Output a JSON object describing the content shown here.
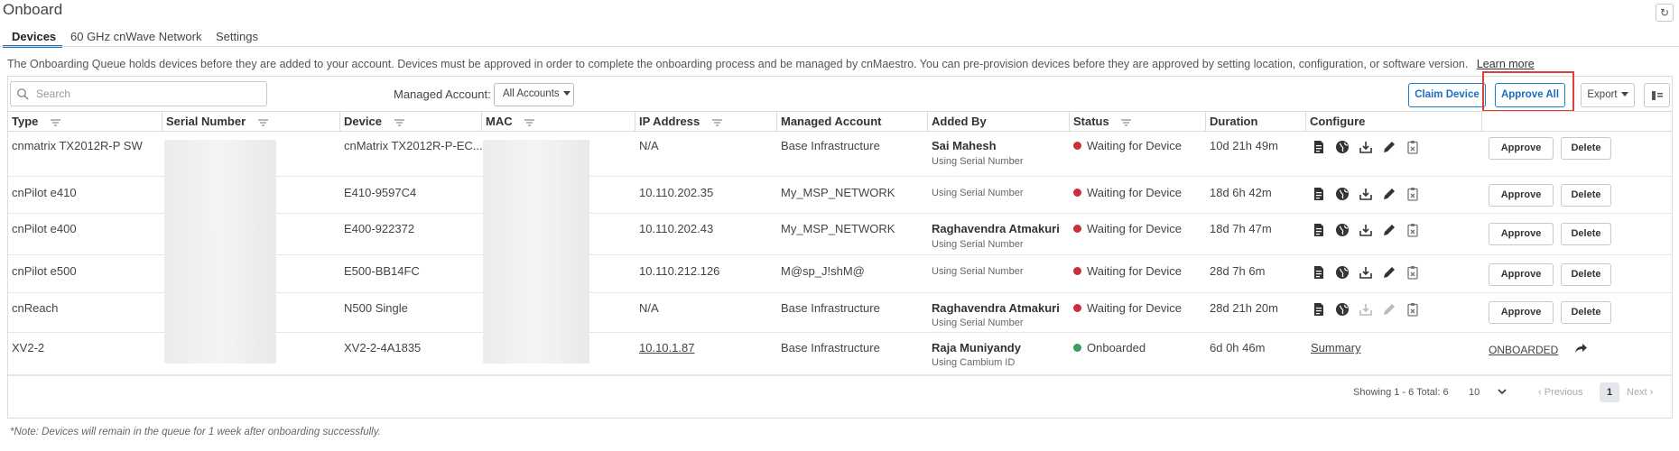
{
  "header": {
    "title": "Onboard",
    "refresh_icon": "refresh-icon"
  },
  "tabs": [
    {
      "label": "Devices",
      "active": true
    },
    {
      "label": "60 GHz cnWave Network",
      "active": false
    },
    {
      "label": "Settings",
      "active": false
    }
  ],
  "info": {
    "text": "The Onboarding Queue holds devices before they are added to your account. Devices must be approved in order to complete the onboarding process and be managed by cnMaestro. You can pre-provision devices before they are approved by setting location, configuration, or software version.",
    "learn_more": "Learn more"
  },
  "toolbar": {
    "search_placeholder": "Search",
    "search_value": "",
    "managed_account_label": "Managed Account:",
    "managed_account_value": "All Accounts",
    "claim_device": "Claim Device",
    "approve_all": "Approve All",
    "export": "Export",
    "columns_icon": "columns-icon"
  },
  "columns": [
    "Type",
    "Serial Number",
    "Device",
    "MAC",
    "IP Address",
    "Managed Account",
    "Added By",
    "Status",
    "Duration",
    "Configure"
  ],
  "rows": [
    {
      "type": "cnmatrix TX2012R-P SW",
      "device": "cnMatrix TX2012R-P-EC...",
      "ip": "N/A",
      "account": "Base Infrastructure",
      "added_by": "Sai Mahesh",
      "added_via": "Using Serial Number",
      "status": "Waiting for Device",
      "duration": "10d 21h 49m",
      "action1": "Approve",
      "action2": "Delete"
    },
    {
      "type": "cnPilot e410",
      "device": "E410-9597C4",
      "ip": "10.110.202.35",
      "account": "My_MSP_NETWORK",
      "added_by": "",
      "added_via": "Using Serial Number",
      "status": "Waiting for Device",
      "duration": "18d 6h 42m",
      "action1": "Approve",
      "action2": "Delete"
    },
    {
      "type": "cnPilot e400",
      "device": "E400-922372",
      "ip": "10.110.202.43",
      "account": "My_MSP_NETWORK",
      "added_by": "Raghavendra Atmakuri",
      "added_via": "Using Serial Number",
      "status": "Waiting for Device",
      "duration": "18d 7h 47m",
      "action1": "Approve",
      "action2": "Delete"
    },
    {
      "type": "cnPilot e500",
      "device": "E500-BB14FC",
      "ip": "10.110.212.126",
      "account": "M@sp_J!shM@",
      "added_by": "",
      "added_via": "Using Serial Number",
      "status": "Waiting for Device",
      "duration": "28d 7h 6m",
      "action1": "Approve",
      "action2": "Delete"
    },
    {
      "type": "cnReach",
      "device": "N500 Single",
      "ip": "N/A",
      "account": "Base Infrastructure",
      "added_by": "Raghavendra Atmakuri",
      "added_via": "Using Serial Number",
      "status": "Waiting for Device",
      "duration": "28d 21h 20m",
      "action1": "Approve",
      "action2": "Delete"
    },
    {
      "type": "XV2-2",
      "device": "XV2-2-4A1835",
      "ip": "10.10.1.87",
      "account": "Base Infrastructure",
      "added_by": "Raja Muniyandy",
      "added_via": "Using Cambium ID",
      "status": "Onboarded",
      "duration": "6d 0h 46m",
      "configure_link": "Summary",
      "onboarded_label": "ONBOARDED"
    }
  ],
  "pager": {
    "showing": "Showing 1 - 6 Total: 6",
    "page_size": "10",
    "previous": "Previous",
    "current_page": "1",
    "next": "Next"
  },
  "note": "*Note: Devices will remain in the queue for 1 week after onboarding successfully.",
  "colors": {
    "accent": "#1a6fbf",
    "waiting": "#c8303a",
    "onboarded": "#3a9e5c",
    "highlight": "#e0403a"
  }
}
